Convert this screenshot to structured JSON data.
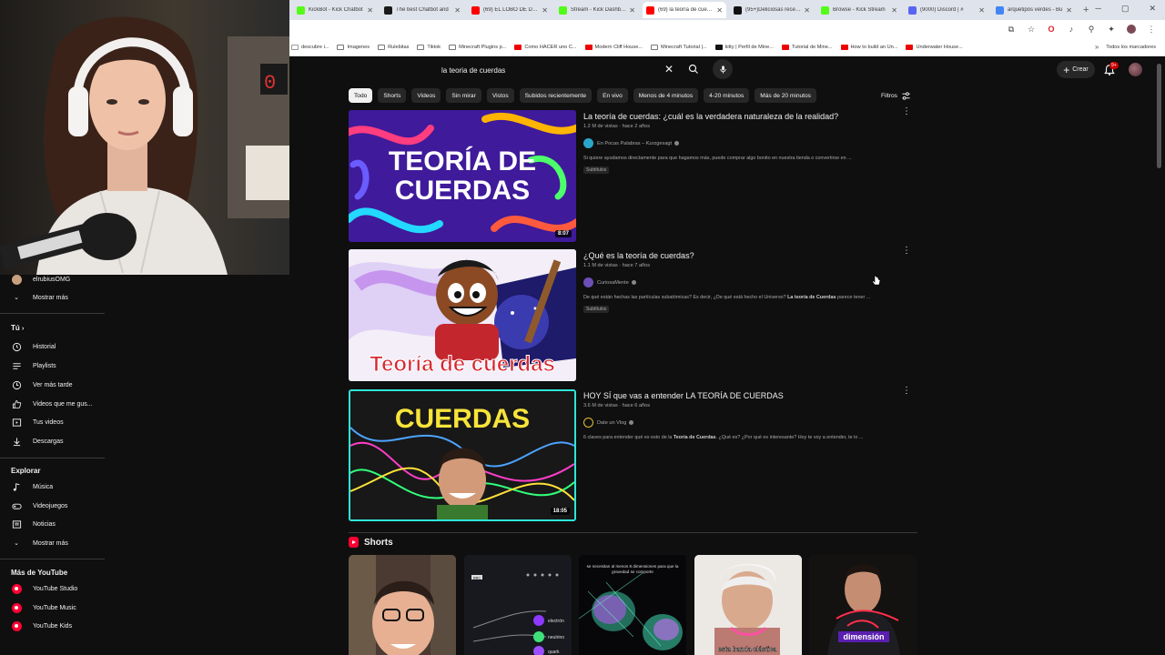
{
  "browser": {
    "tabs": [
      {
        "label": "KickBot - Kick Chatbot",
        "color": "#53fc18"
      },
      {
        "label": "The best Chatbot and",
        "color": "#1a1a1a"
      },
      {
        "label": "(69) EL LOBO DE DAKI",
        "color": "#ff0000"
      },
      {
        "label": "Stream - Kick Dashboard",
        "color": "#53fc18"
      },
      {
        "label": "(69) la teoría de cuerdas",
        "color": "#ff0000"
      },
      {
        "label": "(95+)Deliciosas recetas",
        "color": "#111111"
      },
      {
        "label": "Browse - Kick Stream",
        "color": "#53fc18"
      },
      {
        "label": "(9000) Discord | #",
        "color": "#5865f2"
      },
      {
        "label": "arquetipos verdes - Bu",
        "color": "#4285f4"
      }
    ],
    "bookmarks": [
      "descubre i...",
      "Imagenes",
      "Rulebitas",
      "Tiktok",
      "Minecraft Plugins p...",
      "Como HACER uno C...",
      "Modern Cliff House...",
      "Minecraft Tutorial |...",
      "kitty | Perfil de Mine...",
      "Tutorial de Mine...",
      "How to build an Un...",
      "Underwater House..."
    ],
    "all_bookmarks": "Todos los marcadores"
  },
  "header": {
    "search_query": "la teoria de cuerdas",
    "create_label": "Crear",
    "notif_badge": "9+"
  },
  "chips": [
    "Todo",
    "Shorts",
    "Videos",
    "Sin mirar",
    "Vistos",
    "Subidos recientemente",
    "En vivo",
    "Menos de 4 minutos",
    "4-20 minutos",
    "Más de 20 minutos"
  ],
  "filters_label": "Filtros",
  "sidebar": {
    "channel_partial": "elrubiusOMG",
    "show_more_1": "Mostrar más",
    "you_header": "Tú",
    "you_items": [
      "Historial",
      "Playlists",
      "Ver más tarde",
      "Videos que me gus...",
      "Tus videos",
      "Descargas"
    ],
    "explore_header": "Explorar",
    "explore_items": [
      "Música",
      "Videojuegos",
      "Noticias",
      "Mostrar más"
    ],
    "more_header": "Más de YouTube",
    "more_items": [
      "YouTube Studio",
      "YouTube Music",
      "YouTube Kids"
    ]
  },
  "results": [
    {
      "title": "La teoría de cuerdas: ¿cuál es la verdadera naturaleza de la realidad?",
      "meta": "1.2 M de vistas · hace 2 años",
      "channel": "En Pocas Palabras – Kurzgesagt",
      "desc": "Si quiere ayudamos directamente para que hagamos más, puede comprar algo bonito en nuestra tienda o convertirse en ...",
      "badge": "Subtítulos",
      "duration": "8:07",
      "thumb_text_1": "TEORÍA DE",
      "thumb_text_2": "CUERDAS"
    },
    {
      "title": "¿Qué es la teoría de cuerdas?",
      "meta": "1.1 M de vistas · hace 7 años",
      "channel": "CuriosaMente",
      "desc_pre": "De qué están hechas las partículas subatómicas? Es decir, ¿De qué está hecho el Universo? ",
      "desc_bold": "La teoría de Cuerdas",
      "desc_post": " parece tener ...",
      "badge": "Subtítulos",
      "thumb_text": "Teoría de cuerdas"
    },
    {
      "title": "HOY SÍ que vas a entender LA TEORÍA DE CUERDAS",
      "meta": "3.6 M de vistas · hace 6 años",
      "channel": "Date un Vlog",
      "desc_pre": "6 claves para entender qué es esto de la ",
      "desc_bold": "Teoría de Cuerdas",
      "desc_post": ". ¿Qué es? ¿Por qué es interesante? Hoy te voy a entender, te lo ...",
      "duration": "18:05",
      "thumb_text": "CUERDAS"
    }
  ],
  "shorts": {
    "header": "Shorts",
    "items": [
      {
        "overlay": ""
      },
      {
        "overlay": "electrón · neutrino · quark",
        "tag": "BBC"
      },
      {
        "overlay": "se necesitan al menos 8 dimensiones para que la gravedad se comporte"
      },
      {
        "overlay": "esta banda elástica"
      },
      {
        "overlay": "dimensión"
      }
    ]
  }
}
